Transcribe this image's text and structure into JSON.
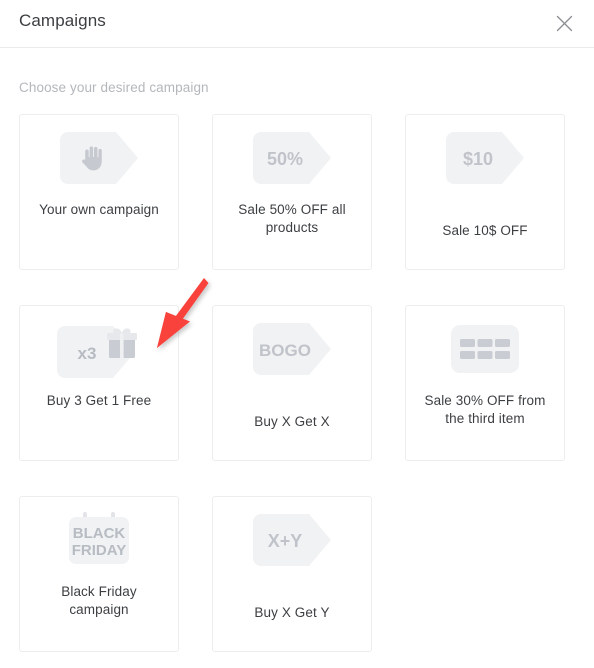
{
  "modal": {
    "title": "Campaigns",
    "close_icon": "close-icon",
    "subtitle": "Choose your desired campaign"
  },
  "colors": {
    "title_text": "#3c3f42",
    "subtitle_text": "#b4b7bb",
    "card_border": "#ededed",
    "icon_background": "#f1f2f4",
    "icon_glyph": "#c6cad0",
    "annotation_arrow": "#f9423a"
  },
  "cards": [
    {
      "label": "Your own campaign",
      "icon": "tag-hand-icon",
      "icon_text": "",
      "lines": 2
    },
    {
      "label": "Sale 50% OFF all products",
      "icon": "tag-percent-icon",
      "icon_text": "50%",
      "lines": 2
    },
    {
      "label": "Sale 10$ OFF",
      "icon": "tag-amount-icon",
      "icon_text": "$10",
      "lines": 1
    },
    {
      "label": "Buy 3 Get 1 Free",
      "icon": "tag-gift-icon",
      "icon_text": "x3",
      "lines": 2
    },
    {
      "label": "Buy X Get X",
      "icon": "tag-bogo-icon",
      "icon_text": "BOGO",
      "lines": 1
    },
    {
      "label": "Sale 30% OFF from the third item",
      "icon": "grid-items-icon",
      "icon_text": "",
      "lines": 3
    },
    {
      "label": "Black Friday campaign",
      "icon": "calendar-black-friday-icon",
      "icon_text": "BLACK FRIDAY",
      "icon_text_line1": "BLACK",
      "icon_text_line2": "FRIDAY",
      "lines": 2
    },
    {
      "label": "Buy X Get Y",
      "icon": "tag-xy-icon",
      "icon_text": "X+Y",
      "lines": 1
    }
  ],
  "annotation": {
    "type": "arrow",
    "points_to": "Buy 3 Get 1 Free",
    "color": "#f9423a"
  }
}
